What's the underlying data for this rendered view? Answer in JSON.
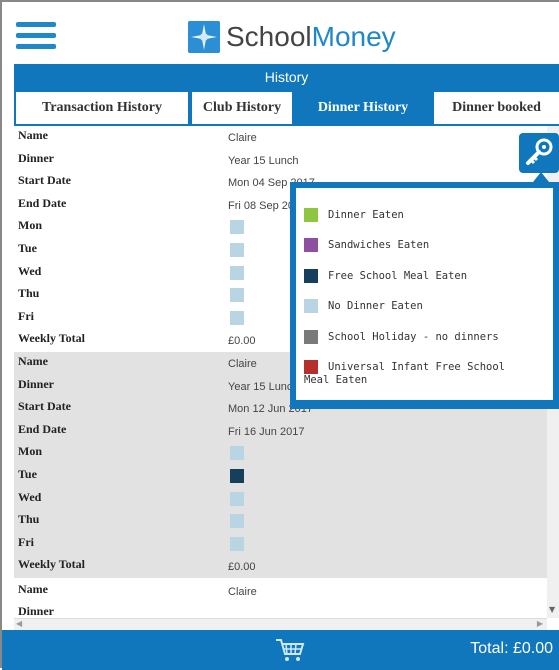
{
  "brand": {
    "part1": "School",
    "part2": "Money"
  },
  "header": {
    "title": "History"
  },
  "tabs": [
    {
      "label": "Transaction History"
    },
    {
      "label": "Club History"
    },
    {
      "label": "Dinner History"
    },
    {
      "label": "Dinner booked"
    }
  ],
  "row_labels": {
    "name": "Name",
    "dinner": "Dinner",
    "start_date": "Start Date",
    "end_date": "End Date",
    "mon": "Mon",
    "tue": "Tue",
    "wed": "Wed",
    "thu": "Thu",
    "fri": "Fri",
    "weekly_total": "Weekly Total"
  },
  "weeks": [
    {
      "name": "Claire",
      "dinner": "Year 15 Lunch",
      "start_date": "Mon 04 Sep 2017",
      "end_date": "Fri 08 Sep 2017",
      "days": [
        "No Dinner Eaten",
        "No Dinner Eaten",
        "No Dinner Eaten",
        "No Dinner Eaten",
        "No Dinner Eaten"
      ],
      "weekly_total": "£0.00"
    },
    {
      "name": "Claire",
      "dinner": "Year 15 Lunch",
      "start_date": "Mon 12 Jun 2017",
      "end_date": "Fri 16 Jun 2017",
      "days": [
        "No Dinner Eaten",
        "Free School Meal Eaten",
        "No Dinner Eaten",
        "No Dinner Eaten",
        "No Dinner Eaten"
      ],
      "weekly_total": "£0.00"
    },
    {
      "name": "Claire",
      "dinner": "Dinner"
    }
  ],
  "legend": [
    {
      "label": "Dinner Eaten",
      "color": "#8dc63f"
    },
    {
      "label": "Sandwiches Eaten",
      "color": "#8e4fa0"
    },
    {
      "label": "Free School Meal Eaten",
      "color": "#163f5c"
    },
    {
      "label": "No Dinner Eaten",
      "color": "#b9d5e3"
    },
    {
      "label": "School Holiday - no dinners",
      "color": "#7a7a7a"
    },
    {
      "label": "Universal Infant Free School Meal Eaten",
      "color": "#b5302b"
    }
  ],
  "footer": {
    "total": "Total: £0.00"
  },
  "icons": {
    "menu": "hamburger-icon",
    "key": "key-icon",
    "cart": "cart-icon"
  },
  "colors": {
    "brand_blue": "#1077bd"
  }
}
